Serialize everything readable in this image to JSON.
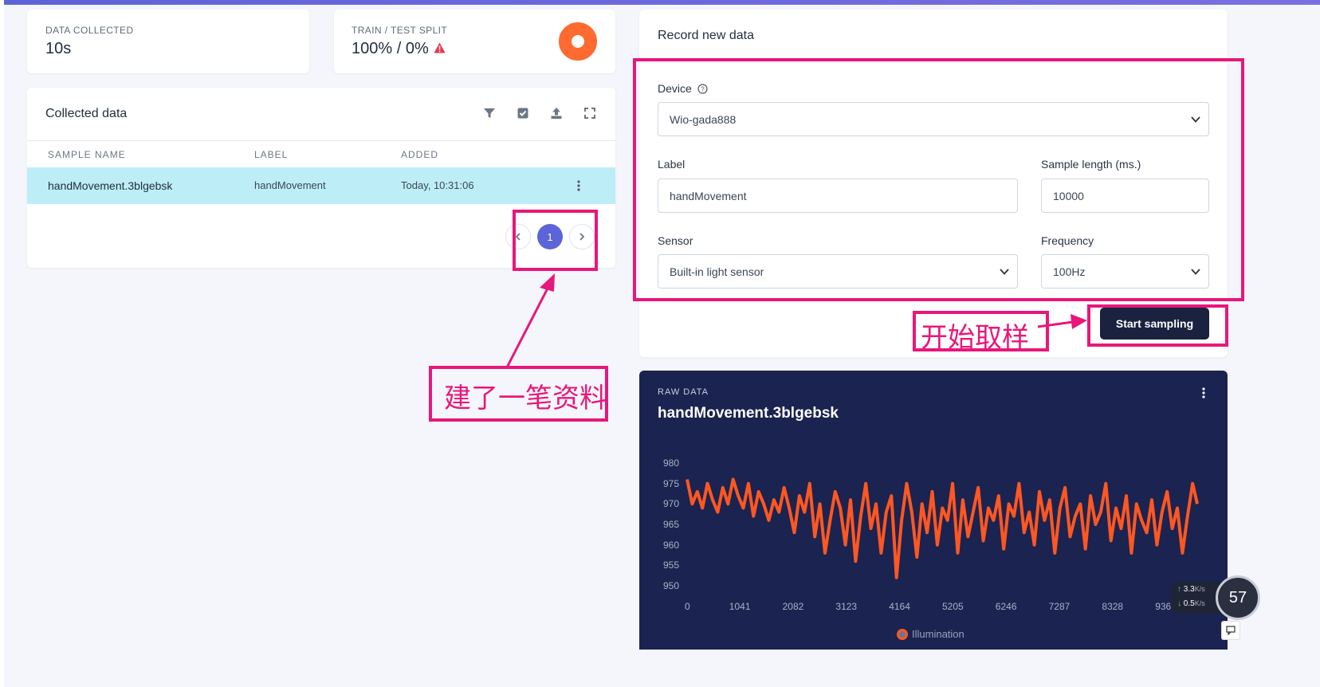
{
  "stats": {
    "data_collected_label": "DATA COLLECTED",
    "data_collected_value": "10s",
    "split_label": "TRAIN / TEST SPLIT",
    "split_value": "100% / 0%"
  },
  "collected": {
    "title": "Collected data",
    "columns": [
      "SAMPLE NAME",
      "LABEL",
      "ADDED"
    ],
    "rows": [
      {
        "name": "handMovement.3blgebsk",
        "label": "handMovement",
        "added": "Today, 10:31:06"
      }
    ],
    "page": "1"
  },
  "record": {
    "title": "Record new data",
    "device_label": "Device",
    "device_value": "Wio-gada888",
    "label_label": "Label",
    "label_value": "handMovement",
    "length_label": "Sample length (ms.)",
    "length_value": "10000",
    "sensor_label": "Sensor",
    "sensor_value": "Built-in light sensor",
    "frequency_label": "Frequency",
    "frequency_value": "100Hz",
    "start_button": "Start sampling"
  },
  "annotations": {
    "created_note": "建了一笔资料",
    "start_note": "开始取样"
  },
  "raw": {
    "section_label": "RAW DATA",
    "sample_title": "handMovement.3blgebsk"
  },
  "network": {
    "up": "3.3",
    "down": "0.5",
    "unit": "K/s",
    "percent": "57"
  },
  "colors": {
    "accent": "#5c64d9",
    "chart_bg": "#1b2350",
    "line": "#ff5722",
    "annotation": "#e8177a",
    "button": "#1a2240",
    "selected_row": "#bdeef7"
  },
  "chart_data": {
    "type": "line",
    "x_ticks": [
      "0",
      "1041",
      "2082",
      "3123",
      "4164",
      "5205",
      "6246",
      "7287",
      "8328",
      "936"
    ],
    "y_ticks": [
      "980",
      "975",
      "970",
      "965",
      "960",
      "955",
      "950"
    ],
    "ylim": [
      950,
      980
    ],
    "xlim": [
      0,
      9990
    ],
    "series": [
      {
        "name": "Illumination",
        "x": [
          0,
          100,
          200,
          300,
          400,
          500,
          600,
          700,
          800,
          900,
          1000,
          1100,
          1200,
          1300,
          1400,
          1500,
          1600,
          1700,
          1800,
          1900,
          2000,
          2100,
          2200,
          2300,
          2400,
          2500,
          2600,
          2700,
          2800,
          2900,
          3000,
          3100,
          3200,
          3300,
          3400,
          3500,
          3600,
          3700,
          3800,
          3900,
          4000,
          4100,
          4200,
          4300,
          4400,
          4500,
          4600,
          4700,
          4800,
          4900,
          5000,
          5100,
          5200,
          5300,
          5400,
          5500,
          5600,
          5700,
          5800,
          5900,
          6000,
          6100,
          6200,
          6300,
          6400,
          6500,
          6600,
          6700,
          6800,
          6900,
          7000,
          7100,
          7200,
          7300,
          7400,
          7500,
          7600,
          7700,
          7800,
          7900,
          8000,
          8100,
          8200,
          8300,
          8400,
          8500,
          8600,
          8700,
          8800,
          8900,
          9000,
          9100,
          9200,
          9300,
          9400,
          9500,
          9600,
          9700,
          9800,
          9900,
          9990
        ],
        "values": [
          976,
          970,
          973,
          969,
          975,
          971,
          968,
          974,
          970,
          976,
          972,
          969,
          975,
          967,
          973,
          970,
          966,
          971,
          968,
          974,
          969,
          963,
          972,
          968,
          975,
          962,
          970,
          958,
          966,
          973,
          969,
          960,
          971,
          956,
          967,
          975,
          964,
          970,
          958,
          968,
          972,
          952,
          966,
          975,
          968,
          957,
          970,
          963,
          973,
          960,
          969,
          966,
          975,
          958,
          971,
          962,
          968,
          974,
          961,
          969,
          966,
          972,
          959,
          970,
          967,
          975,
          963,
          968,
          960,
          973,
          966,
          971,
          958,
          969,
          974,
          962,
          967,
          970,
          959,
          972,
          965,
          968,
          975,
          961,
          969,
          964,
          972,
          958,
          970,
          966,
          963,
          971,
          960,
          968,
          973,
          964,
          969,
          958,
          967,
          975,
          970
        ]
      }
    ]
  }
}
